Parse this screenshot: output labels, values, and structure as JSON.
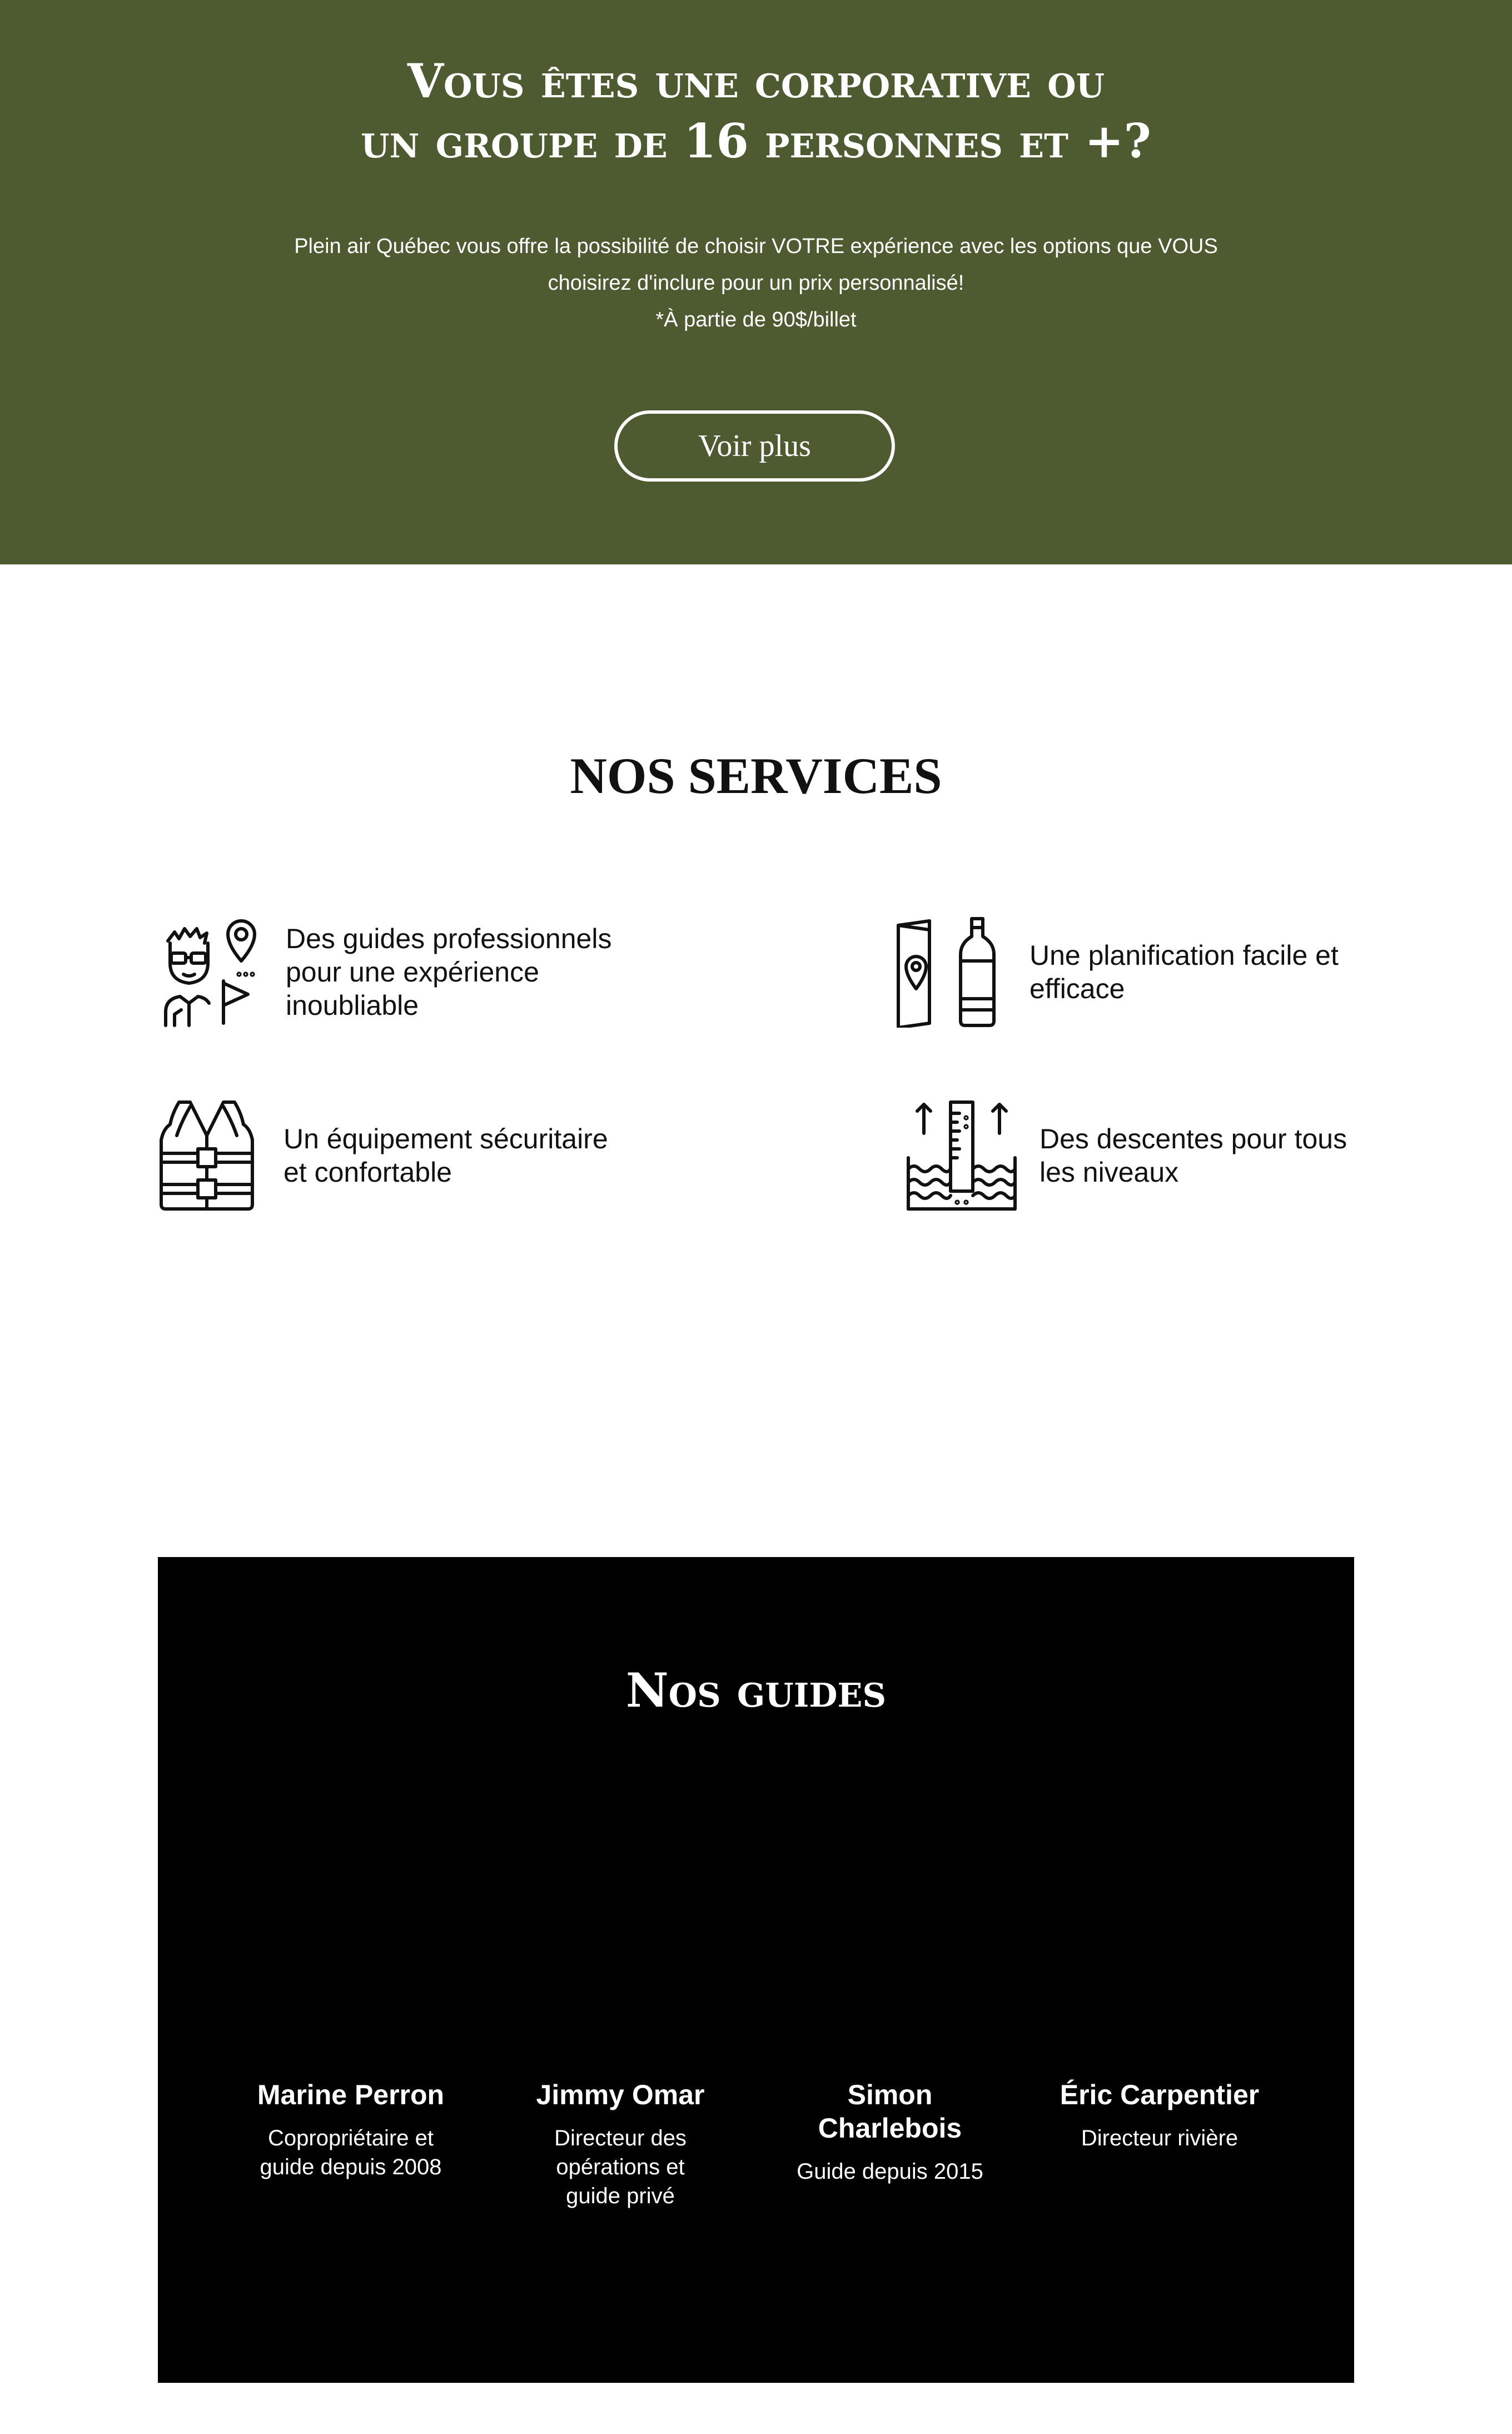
{
  "hero": {
    "title_line1": "Vous êtes une corporative ou",
    "title_line2": "un groupe de 16 personnes et +?",
    "text_line1": "Plein air Québec vous offre la possibilité de choisir VOTRE expérience avec les options que VOUS",
    "text_line2": "choisirez d'inclure pour un prix personnalisé!",
    "text_line3": "*À partie de 90$/billet",
    "button_label": "Voir plus",
    "background_color": "#4e5b30"
  },
  "services": {
    "title": "NOS SERVICES",
    "items": [
      {
        "icon": "guide-person-icon",
        "label": "Des guides professionnels\npour une expérience\ninoubliable"
      },
      {
        "icon": "map-bottle-icon",
        "label": "Une planification facile et\nefficace"
      },
      {
        "icon": "life-vest-icon",
        "label": "Un équipement sécuritaire\net confortable"
      },
      {
        "icon": "water-level-icon",
        "label": "Des descentes pour tous\nles niveaux"
      }
    ]
  },
  "guides": {
    "title": "Nos guides",
    "items": [
      {
        "name": "Marine Perron",
        "role": "Copropriétaire et\nguide depuis 2008"
      },
      {
        "name": "Jimmy Omar",
        "role": "Directeur des\nopérations et\nguide privé"
      },
      {
        "name": "Simon Charlebois",
        "role": "Guide depuis 2015"
      },
      {
        "name": "Éric Carpentier",
        "role": "Directeur rivière"
      }
    ]
  }
}
